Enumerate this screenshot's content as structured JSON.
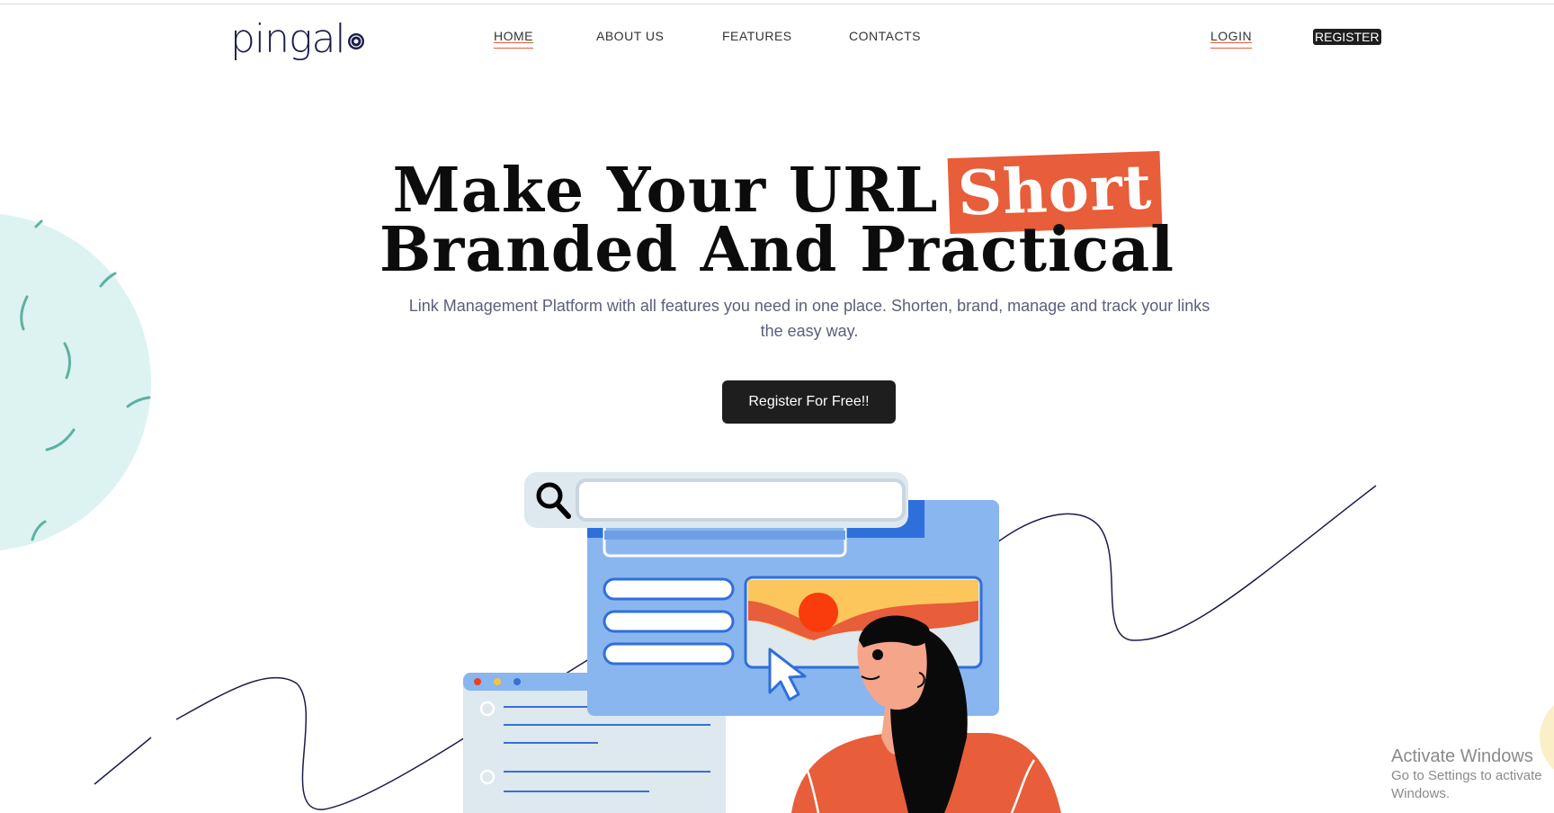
{
  "brand": {
    "logo_text": "pingal"
  },
  "nav": {
    "items": [
      {
        "label": "HOME",
        "active": true
      },
      {
        "label": "ABOUT US",
        "active": false
      },
      {
        "label": "FEATURES",
        "active": false
      },
      {
        "label": "CONTACTS",
        "active": false
      }
    ],
    "login_label": "LOGIN",
    "register_label": "REGISTER"
  },
  "hero": {
    "title_line1": "Make Your URL",
    "title_highlight": "Short",
    "title_line2": "Branded And Practical",
    "subtitle": "Link Management Platform with all features you need in one place. Shorten, brand, manage and track your links the easy way.",
    "cta_label": "Register For Free!!"
  },
  "watermark": {
    "title": "Activate Windows",
    "subtitle": "Go to Settings to activate Windows."
  },
  "colors": {
    "accent": "#e85d3a",
    "dark": "#1e1e1e",
    "navy": "#1b1d4a",
    "mint": "#dcf3f1",
    "panel_blue": "#8ab6ef",
    "light_blue": "#dde8ef"
  },
  "icons": [
    "search-icon",
    "cursor-icon",
    "logo-mark-icon"
  ]
}
